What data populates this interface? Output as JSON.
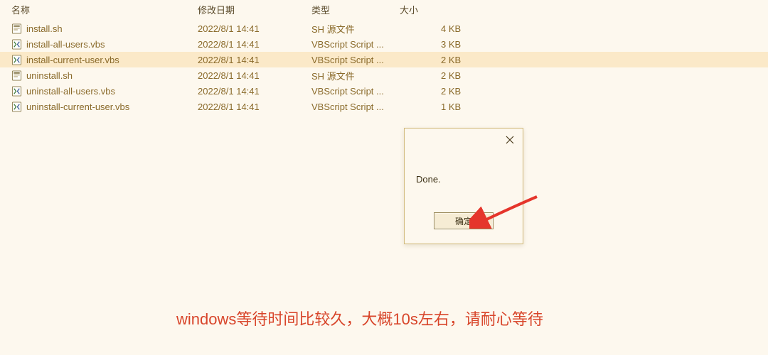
{
  "headers": {
    "name": "名称",
    "date": "修改日期",
    "type": "类型",
    "size": "大小"
  },
  "files": [
    {
      "icon": "sh",
      "name": "install.sh",
      "date": "2022/8/1 14:41",
      "type": "SH 源文件",
      "size": "4 KB",
      "selected": false
    },
    {
      "icon": "vbs",
      "name": "install-all-users.vbs",
      "date": "2022/8/1 14:41",
      "type": "VBScript Script ...",
      "size": "3 KB",
      "selected": false
    },
    {
      "icon": "vbs",
      "name": "install-current-user.vbs",
      "date": "2022/8/1 14:41",
      "type": "VBScript Script ...",
      "size": "2 KB",
      "selected": true
    },
    {
      "icon": "sh",
      "name": "uninstall.sh",
      "date": "2022/8/1 14:41",
      "type": "SH 源文件",
      "size": "2 KB",
      "selected": false
    },
    {
      "icon": "vbs",
      "name": "uninstall-all-users.vbs",
      "date": "2022/8/1 14:41",
      "type": "VBScript Script ...",
      "size": "2 KB",
      "selected": false
    },
    {
      "icon": "vbs",
      "name": "uninstall-current-user.vbs",
      "date": "2022/8/1 14:41",
      "type": "VBScript Script ...",
      "size": "1 KB",
      "selected": false
    }
  ],
  "dialog": {
    "message": "Done.",
    "ok_label": "确定"
  },
  "annotation": "windows等待时间比较久，大概10s左右，请耐心等待",
  "colors": {
    "arrow": "#e5352b",
    "annotation_text": "#d8452a",
    "row_text": "#8a6a2a",
    "selected_bg": "#fbe9c8"
  }
}
